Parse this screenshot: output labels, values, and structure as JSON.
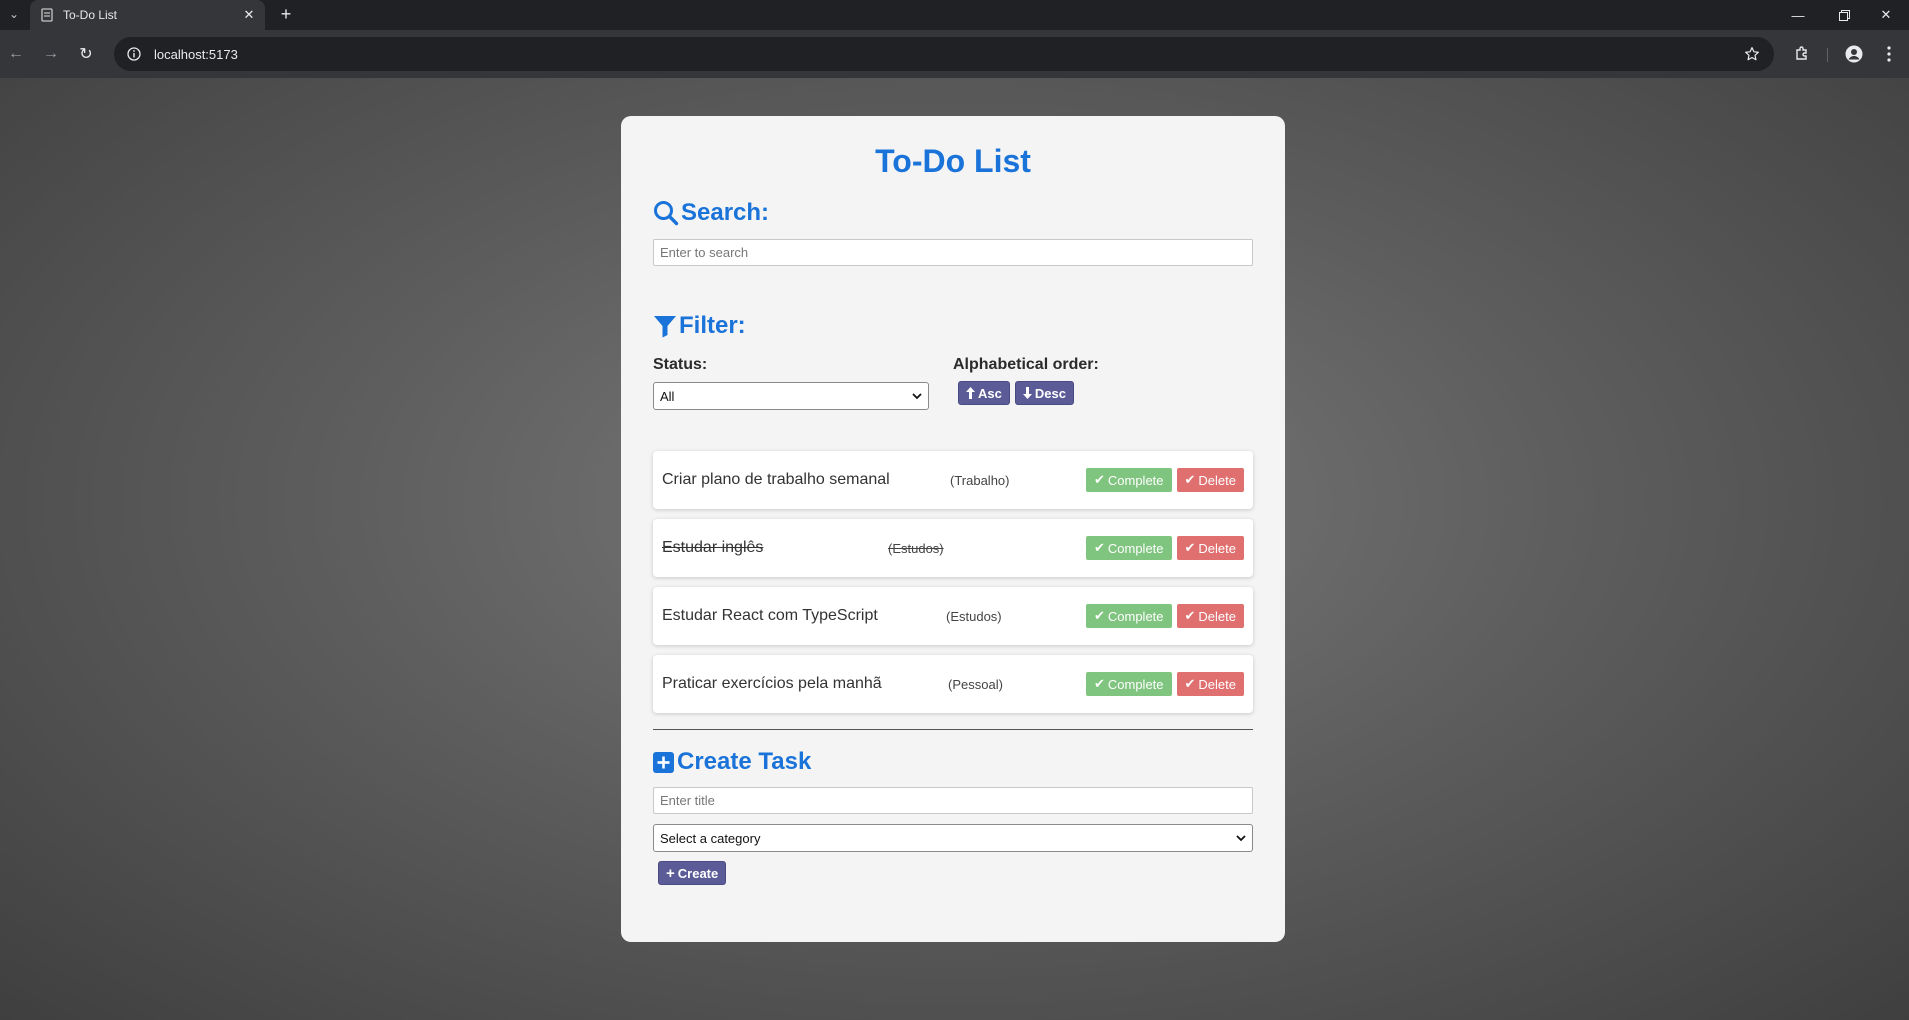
{
  "browser": {
    "tab_title": "To-Do List",
    "url": "localhost:5173"
  },
  "app": {
    "title": "To-Do List",
    "search": {
      "heading": "Search:",
      "placeholder": "Enter to search"
    },
    "filter": {
      "heading": "Filter:",
      "status_label": "Status:",
      "status_value": "All",
      "order_label": "Alphabetical order:",
      "asc_label": "Asc",
      "desc_label": "Desc"
    },
    "todos": [
      {
        "title": "Criar plano de trabalho semanal",
        "category": "(Trabalho)",
        "completed": false
      },
      {
        "title": "Estudar inglês",
        "category": "(Estudos)",
        "completed": true
      },
      {
        "title": "Estudar React com TypeScript",
        "category": "(Estudos)",
        "completed": false
      },
      {
        "title": "Praticar exercícios pela manhã",
        "category": "(Pessoal)",
        "completed": false
      }
    ],
    "actions": {
      "complete_label": "Complete",
      "delete_label": "Delete"
    },
    "create": {
      "heading": "Create Task",
      "title_placeholder": "Enter title",
      "category_placeholder": "Select a category",
      "button_label": "Create"
    },
    "colors": {
      "accent": "#1a73d9",
      "purple_button": "#5b5c97",
      "complete_green": "#7fc47f",
      "delete_red": "#e07070"
    }
  }
}
